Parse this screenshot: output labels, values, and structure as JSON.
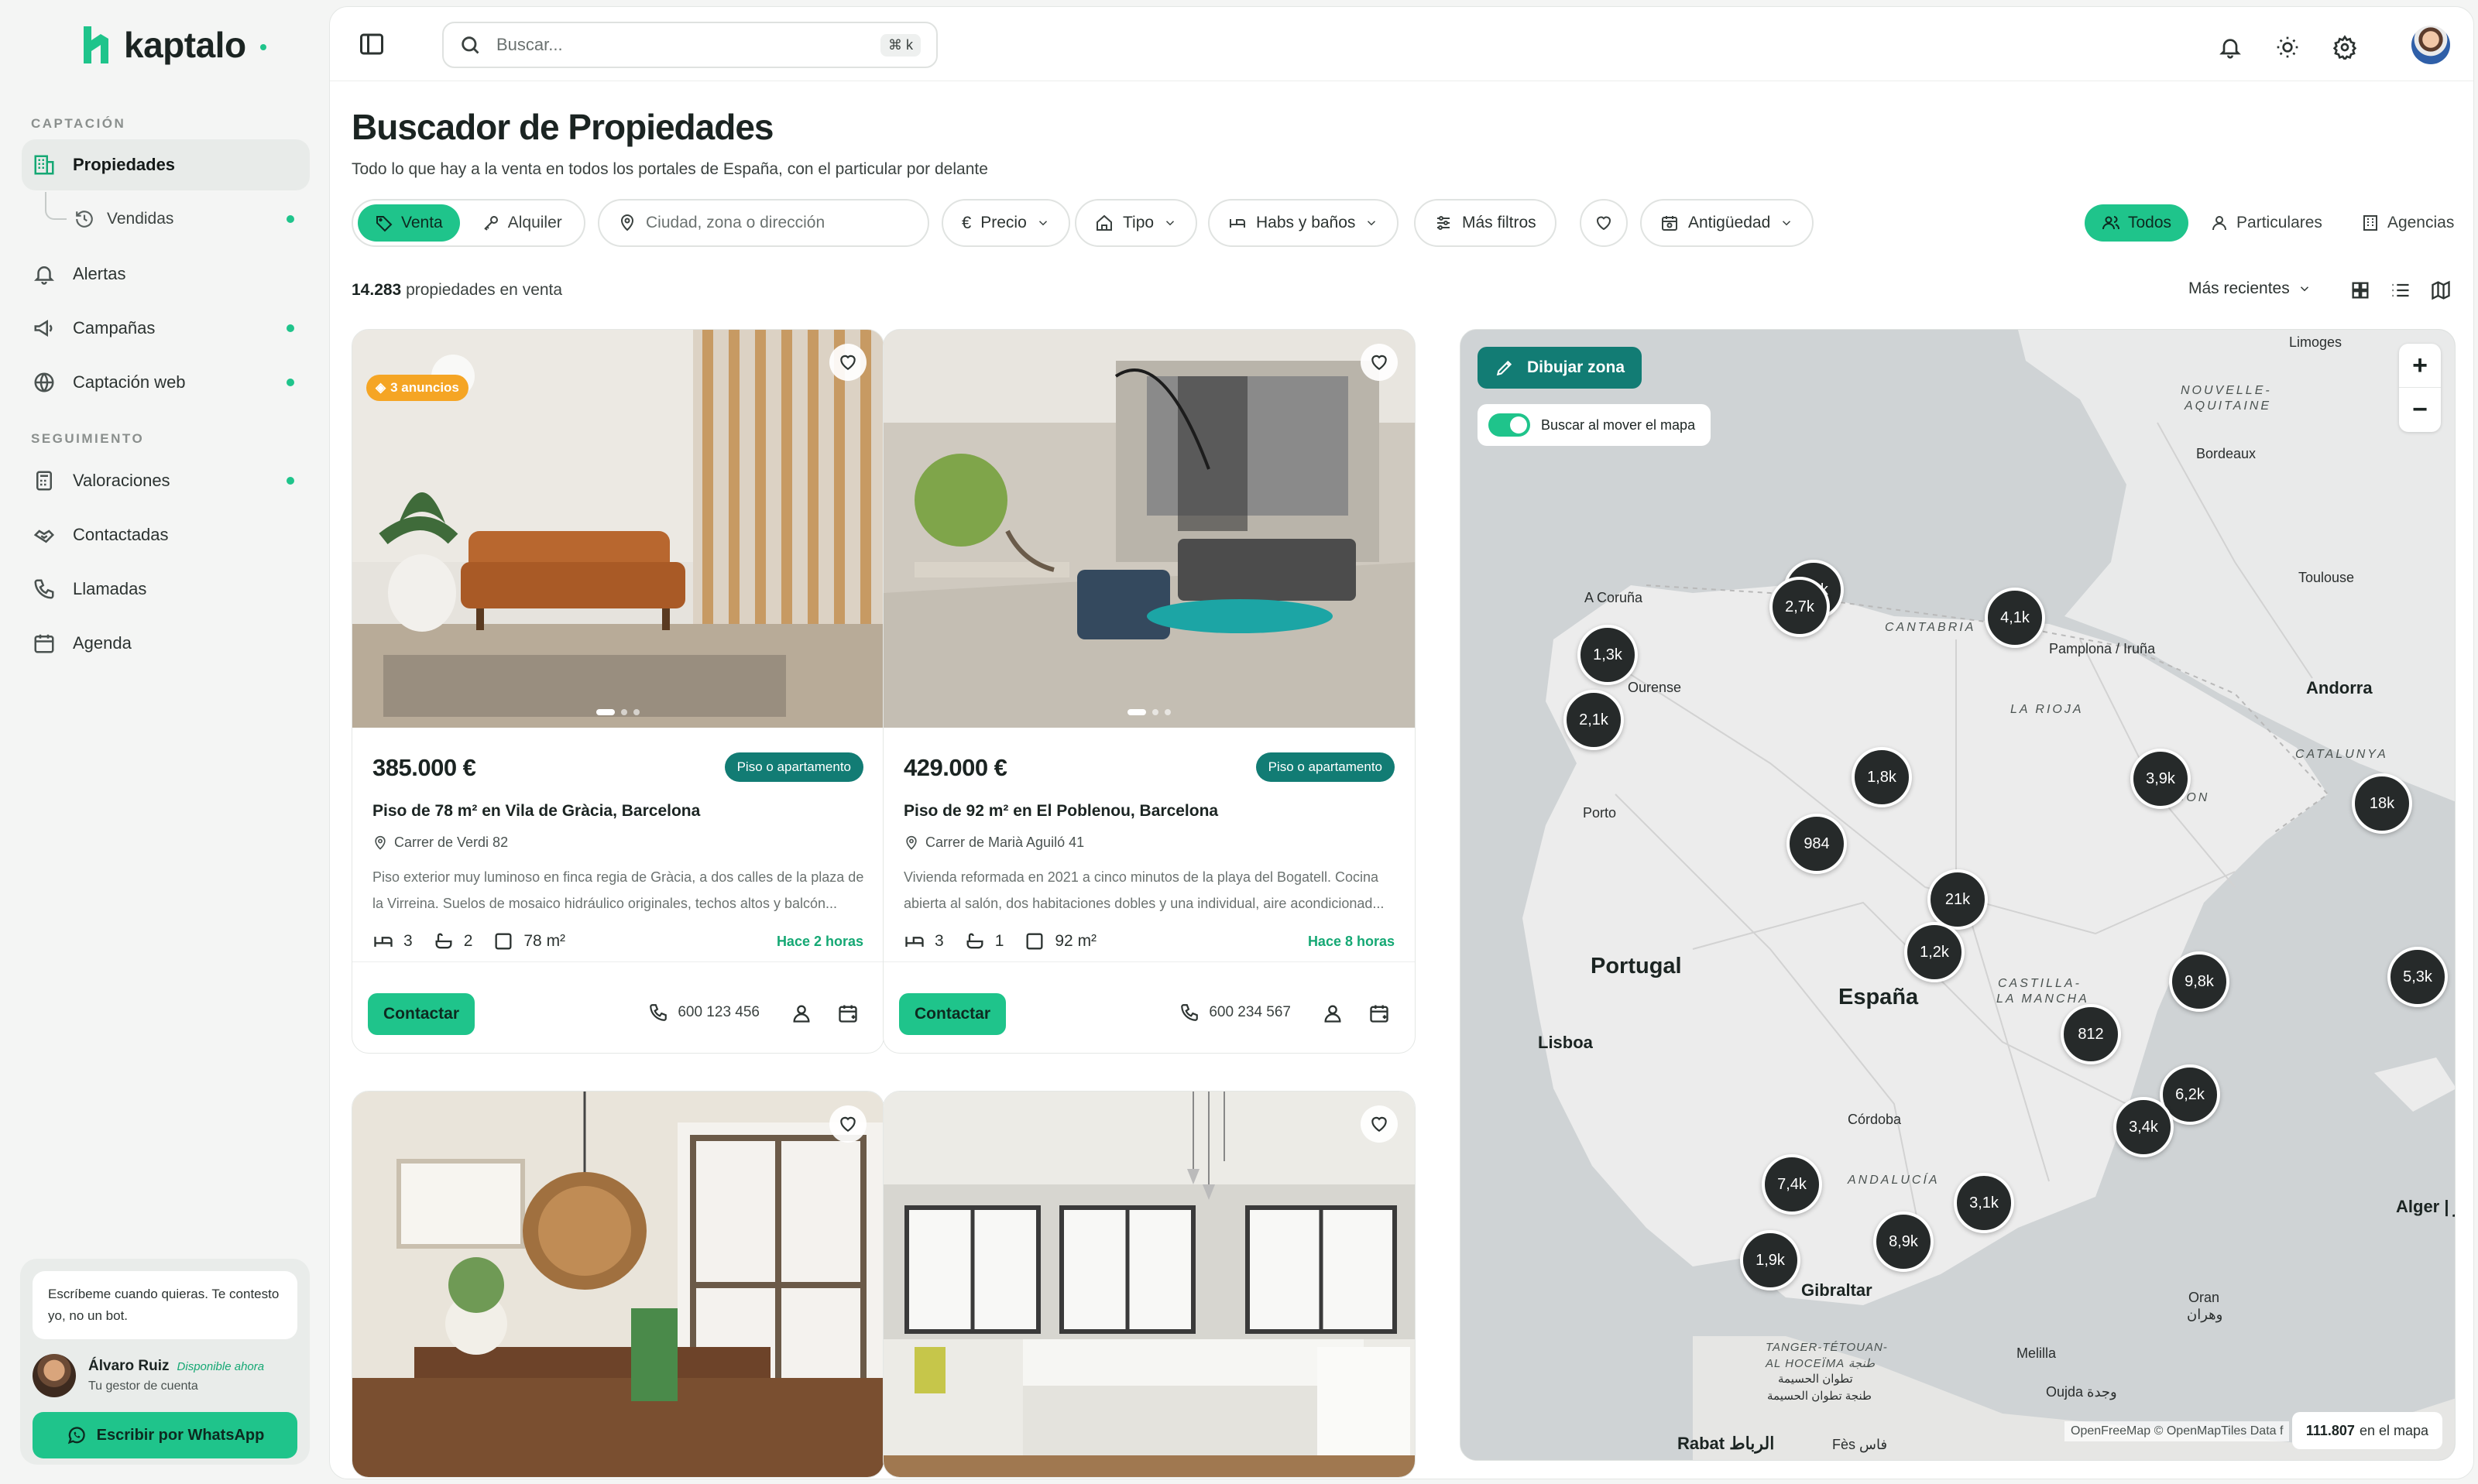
{
  "brand": {
    "name": "kaptalo",
    "accent": "#1fc48b",
    "teal": "#127c74"
  },
  "sidebar": {
    "section_capture": "CAPTACIÓN",
    "section_follow": "SEGUIMIENTO",
    "items": [
      {
        "label": "Propiedades",
        "icon": "building-icon"
      },
      {
        "label": "Vendidas",
        "icon": "history-icon"
      },
      {
        "label": "Alertas",
        "icon": "bell-icon"
      },
      {
        "label": "Campañas",
        "icon": "megaphone-icon"
      },
      {
        "label": "Captación web",
        "icon": "globe-icon"
      },
      {
        "label": "Valoraciones",
        "icon": "calculator-icon"
      },
      {
        "label": "Contactadas",
        "icon": "handshake-icon"
      },
      {
        "label": "Llamadas",
        "icon": "phone-icon"
      },
      {
        "label": "Agenda",
        "icon": "calendar-icon"
      }
    ],
    "chat": {
      "message": "Escríbeme cuando quieras. Te contesto yo, no un bot.",
      "agent_name": "Álvaro Ruiz",
      "agent_status": "Disponible ahora",
      "agent_role": "Tu gestor de cuenta",
      "button": "Escribir por WhatsApp"
    }
  },
  "topbar": {
    "search_placeholder": "Buscar...",
    "shortcut": "⌘ k"
  },
  "page": {
    "title": "Buscador de Propiedades",
    "subtitle": "Todo lo que hay a la venta en todos los portales de España, con el particular por delante"
  },
  "filters": {
    "mode": [
      "Venta",
      "Alquiler"
    ],
    "location_placeholder": "Ciudad, zona o dirección",
    "price": "Precio",
    "type": "Tipo",
    "rooms": "Habs y baños",
    "more": "Más filtros",
    "age": "Antigüedad",
    "audience": [
      "Todos",
      "Particulares",
      "Agencias"
    ]
  },
  "results": {
    "count": "14.283",
    "label": "propiedades en venta",
    "sort": "Más recientes"
  },
  "listings": [
    {
      "badge": "3 anuncios",
      "price": "385.000 €",
      "type": "Piso o apartamento",
      "title": "Piso de 78 m² en Vila de Gràcia, Barcelona",
      "address": "Carrer de Verdi 82",
      "description": "Piso exterior muy luminoso en finca regia de Gràcia, a dos calles de la plaza de la Virreina. Suelos de mosaico hidráulico originales, techos altos y balcón...",
      "beds": "3",
      "baths": "2",
      "area": "78 m²",
      "time": "Hace 2 horas",
      "contact": "Contactar",
      "phone": "600 123 456"
    },
    {
      "badge": "",
      "price": "429.000 €",
      "type": "Piso o apartamento",
      "title": "Piso de 92 m² en El Poblenou, Barcelona",
      "address": "Carrer de Marià Aguiló 41",
      "description": "Vivienda reformada en 2021 a cinco minutos de la playa del Bogatell. Cocina abierta al salón, dos habitaciones dobles y una individual, aire acondicionad...",
      "beds": "3",
      "baths": "1",
      "area": "92 m²",
      "time": "Hace 8 horas",
      "contact": "Contactar",
      "phone": "600 234 567"
    }
  ],
  "map": {
    "draw_zone": "Dibujar zona",
    "move_search": "Buscar al mover el mapa",
    "zoom_in": "+",
    "zoom_out": "−",
    "attribution": "OpenFreeMap © OpenMapTiles Data f",
    "count": "111.807",
    "count_label": "en el mapa",
    "clusters": [
      "1,6k",
      "2,7k",
      "4,1k",
      "1,3k",
      "2,1k",
      "1,8k",
      "3,9k",
      "18k",
      "984",
      "21k",
      "1,2k",
      "9,8k",
      "5,3k",
      "812",
      "6,2k",
      "3,4k",
      "7,4k",
      "3,1k",
      "8,9k",
      "1,9k"
    ],
    "places": {
      "limoges": "Limoges",
      "nouvelle_1": "NOUVELLE-",
      "nouvelle_2": "AQUITAINE",
      "bordeaux": "Bordeaux",
      "toulouse": "Toulouse",
      "coruna": "A Coruña",
      "cantabria": "CANTABRIA",
      "pamplona": "Pamplona / Iruña",
      "ourense": "Ourense",
      "larioja": "LA RIOJA",
      "andorra": "Andorra",
      "catalunya": "CATALUNYA",
      "aragon": "ARAGON",
      "porto": "Porto",
      "portugal": "Portugal",
      "espana": "España",
      "castilla_1": "CASTILLA-",
      "castilla_2": "LA MANCHA",
      "lisboa": "Lisboa",
      "cordoba": "Córdoba",
      "andalucia": "ANDALUCÍA",
      "gibraltar": "Gibraltar",
      "alger": "Alger | الجزائر",
      "oran": "Oran",
      "oran_ar": "وهران",
      "melilla": "Melilla",
      "oujda": "Oujda وجدة",
      "tanger_1": "TANGER-TÉTOUAN-",
      "tanger_2": "AL HOCEÏMA طنجة",
      "tanger_3": "تطوان الحسيمة",
      "tanger_4": "طنجة تطوان الحسيمة",
      "rabat": "Rabat الرباط",
      "fes": "Fès فاس"
    }
  }
}
